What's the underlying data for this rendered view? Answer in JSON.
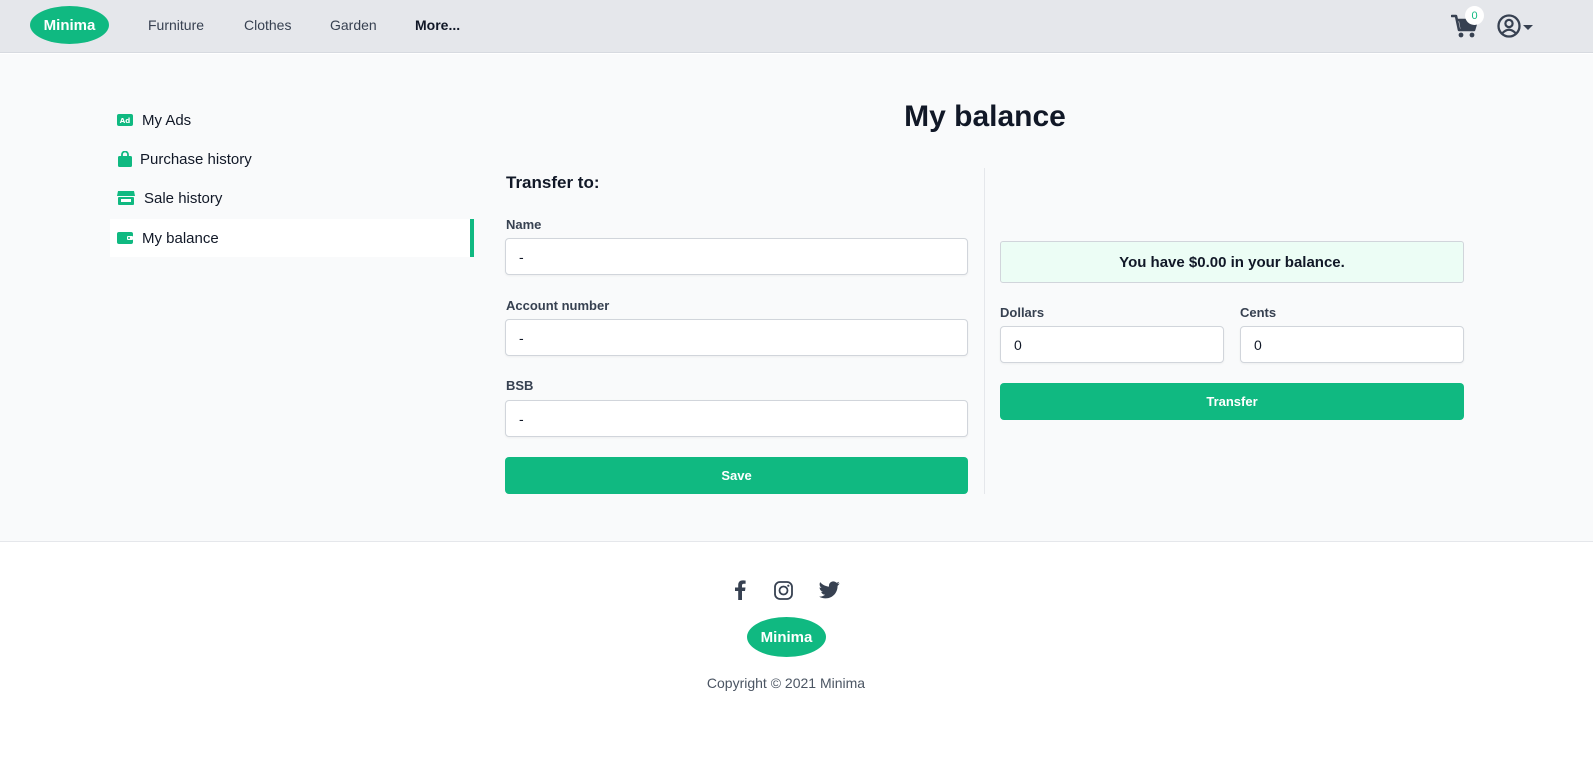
{
  "brand": {
    "name": "Minima",
    "color": "#10b981"
  },
  "header": {
    "nav": [
      "Furniture",
      "Clothes",
      "Garden",
      "More..."
    ],
    "cart_count": "0",
    "cart_icon": "shopping-cart-icon",
    "user_icon": "user-circle-icon"
  },
  "sidebar": {
    "items": [
      {
        "label": "My Ads",
        "icon": "ad-icon",
        "active": false
      },
      {
        "label": "Purchase history",
        "icon": "shopping-bag-icon",
        "active": false
      },
      {
        "label": "Sale history",
        "icon": "store-icon",
        "active": false
      },
      {
        "label": "My balance",
        "icon": "wallet-icon",
        "active": true
      }
    ]
  },
  "main": {
    "title": "My balance",
    "transfer": {
      "heading": "Transfer to:",
      "name_label": "Name",
      "name_value": "-",
      "account_label": "Account number",
      "account_value": "-",
      "bsb_label": "BSB",
      "bsb_value": "-",
      "save_label": "Save"
    },
    "balance": {
      "message": "You have $0.00 in your balance.",
      "dollars_label": "Dollars",
      "dollars_value": "0",
      "cents_label": "Cents",
      "cents_value": "0",
      "transfer_label": "Transfer"
    }
  },
  "footer": {
    "social": [
      "facebook-icon",
      "instagram-icon",
      "twitter-icon"
    ],
    "logo": "Minima",
    "copyright": "Copyright © 2021 Minima"
  }
}
